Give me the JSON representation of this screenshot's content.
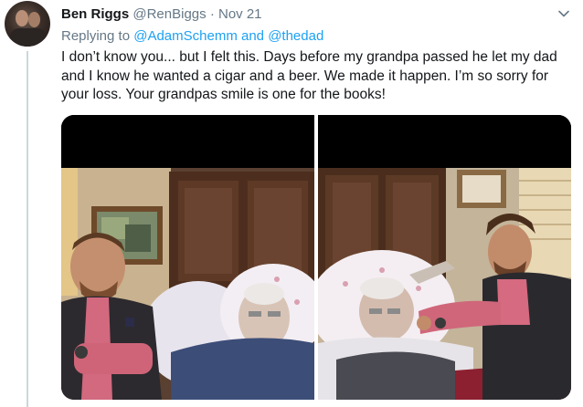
{
  "tweet": {
    "author_name": "Ben Riggs",
    "author_handle": "@RenBiggs",
    "separator": "·",
    "timestamp": "Nov 21",
    "replying_to_prefix": "Replying to",
    "mention_1": "@AdamSchemm",
    "conjunction": "and",
    "mention_2": "@thedad",
    "text": "I don’t know you... but I felt this. Days before my grandpa passed he let my dad and I know he wanted a cigar and a beer. We made it happen. I’m so sorry for your loss. Your grandpas smile is one for the books!"
  },
  "icons": {
    "menu": "chevron-down-icon"
  },
  "colors": {
    "link": "#1da1f2",
    "secondary_text": "#657786",
    "primary_text": "#14171a",
    "thread_line": "#ccd6dd"
  }
}
